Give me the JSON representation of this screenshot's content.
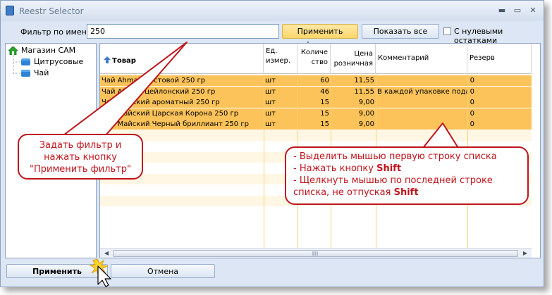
{
  "window": {
    "title": "Reestr Selector",
    "controls": [
      "▬",
      "▭",
      "✕"
    ]
  },
  "filter": {
    "label": "Фильтр по имени",
    "value": "250",
    "apply_label": "Применить фильтр",
    "show_all_label": "Показать все",
    "zero_rest_label": "С нулевыми остатками",
    "zero_rest_checked": false
  },
  "tree": {
    "root": "Магазин САМ",
    "children": [
      "Цитрусовые",
      "Чай"
    ]
  },
  "grid": {
    "columns": [
      "Товар",
      "Ед. измер.",
      "Количе ство",
      "Цена розничная",
      "Комментарий",
      "Резерв"
    ],
    "rows": [
      {
        "name": "Чай Ahmad листовой 250 гр",
        "unit": "шт",
        "qty": "60",
        "price": "11,55",
        "comment": "",
        "reserve": "0"
      },
      {
        "name": "Чай Ahmad цейлонский 250 гр",
        "unit": "шт",
        "qty": "46",
        "price": "11,55",
        "comment": "В каждой упаковке подар",
        "reserve": "0"
      },
      {
        "name": "Чай Майский ароматный 250 гр",
        "unit": "шт",
        "qty": "15",
        "price": "9,00",
        "comment": "",
        "reserve": "0"
      },
      {
        "name": "Чай Майский Царская Корона 250 гр",
        "unit": "шт",
        "qty": "15",
        "price": "9,00",
        "comment": "",
        "reserve": "0"
      },
      {
        "name": "Чай Майский Черный бриллиант 250 гр",
        "unit": "шт",
        "qty": "15",
        "price": "9,00",
        "comment": "",
        "reserve": "0"
      }
    ]
  },
  "buttons": {
    "apply": "Применить",
    "cancel": "Отмена"
  },
  "callouts": {
    "left": [
      "Задать фильтр и",
      "нажать кнопку",
      "\"Применить фильтр\""
    ],
    "right": {
      "line1": "- Выделить мышью первую строку списка",
      "line2_prefix": "- Нажать кнопку ",
      "line2_key": "Shift",
      "line3": "- Щелкнуть мышью по последней строке",
      "line4_prefix": "списка, не отпуская ",
      "line4_key": "Shift"
    }
  },
  "colors": {
    "selection": "#fbc359",
    "callout": "#c0141c",
    "window": "#dce6f4"
  }
}
